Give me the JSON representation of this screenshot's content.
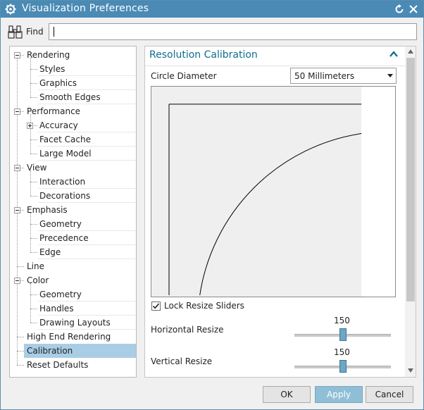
{
  "window": {
    "title": "Visualization Preferences",
    "gear_icon": "gear-icon",
    "reset_icon": "reset-icon",
    "close_icon": "close-icon"
  },
  "find": {
    "label": "Find",
    "value": "",
    "icon": "binoculars-icon"
  },
  "tree": {
    "items": [
      {
        "label": "Rendering",
        "level": 0,
        "toggle": "minus"
      },
      {
        "label": "Styles",
        "level": 1
      },
      {
        "label": "Graphics",
        "level": 1
      },
      {
        "label": "Smooth Edges",
        "level": 1
      },
      {
        "label": "Performance",
        "level": 0,
        "toggle": "minus"
      },
      {
        "label": "Accuracy",
        "level": 1,
        "toggle": "plus"
      },
      {
        "label": "Facet Cache",
        "level": 1
      },
      {
        "label": "Large Model",
        "level": 1
      },
      {
        "label": "View",
        "level": 0,
        "toggle": "minus"
      },
      {
        "label": "Interaction",
        "level": 1
      },
      {
        "label": "Decorations",
        "level": 1
      },
      {
        "label": "Emphasis",
        "level": 0,
        "toggle": "minus"
      },
      {
        "label": "Geometry",
        "level": 1
      },
      {
        "label": "Precedence",
        "level": 1
      },
      {
        "label": "Edge",
        "level": 1
      },
      {
        "label": "Line",
        "level": 0
      },
      {
        "label": "Color",
        "level": 0,
        "toggle": "minus"
      },
      {
        "label": "Geometry",
        "level": 1
      },
      {
        "label": "Handles",
        "level": 1
      },
      {
        "label": "Drawing Layouts",
        "level": 1
      },
      {
        "label": "High End Rendering",
        "level": 0
      },
      {
        "label": "Calibration",
        "level": 0,
        "selected": true
      },
      {
        "label": "Reset Defaults",
        "level": 0
      }
    ]
  },
  "panel": {
    "title": "Resolution Calibration",
    "collapse_icon": "chevron-up-icon",
    "circle_diameter": {
      "label": "Circle Diameter",
      "selected": "50 Millimeters"
    },
    "lock_sliders": {
      "label": "Lock Resize Sliders",
      "checked": true
    },
    "horizontal_resize": {
      "label": "Horizontal Resize",
      "value": "150"
    },
    "vertical_resize": {
      "label": "Vertical Resize",
      "value": "150"
    }
  },
  "buttons": {
    "ok": "OK",
    "apply": "Apply",
    "cancel": "Cancel"
  },
  "colors": {
    "titlebar": "#4a8ab5",
    "selection": "#a9cde4",
    "accent_text": "#0f6d8f"
  }
}
